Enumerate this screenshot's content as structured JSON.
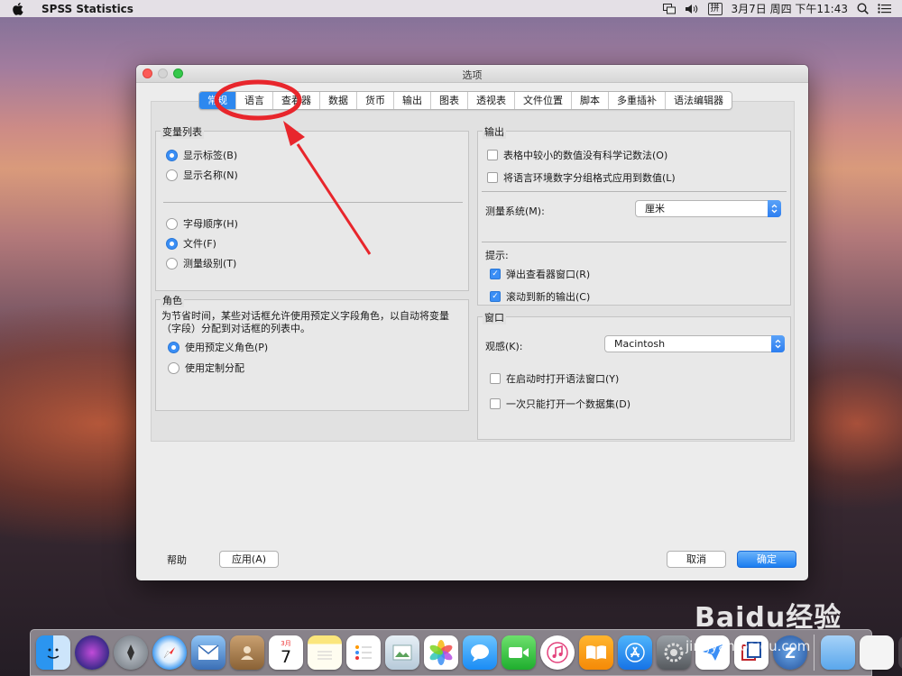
{
  "menubar": {
    "app_name": "SPSS Statistics",
    "input_method": "拼",
    "datetime": "3月7日 周四 下午11:43"
  },
  "window": {
    "title": "选项",
    "tabs": [
      "常规",
      "语言",
      "查看器",
      "数据",
      "货币",
      "输出",
      "图表",
      "透视表",
      "文件位置",
      "脚本",
      "多重插补",
      "语法编辑器"
    ],
    "active_tab": "常规"
  },
  "variable_list": {
    "title": "变量列表",
    "display_label": "显示标签(B)",
    "display_name": "显示名称(N)",
    "alphabetical": "字母顺序(H)",
    "file": "文件(F)",
    "measurement_level": "测量级别(T)"
  },
  "roles": {
    "title": "角色",
    "description": "为节省时间，某些对话框允许使用预定义字段角色，以自动将变量（字段）分配到对话框的列表中。",
    "use_predefined": "使用预定义角色(P)",
    "use_custom": "使用定制分配"
  },
  "output": {
    "title": "输出",
    "no_sci_notation": "表格中较小的数值没有科学记数法(O)",
    "apply_locale_format": "将语言环境数字分组格式应用到数值(L)",
    "measurement_system_label": "测量系统(M):",
    "measurement_system_value": "厘米",
    "notification_label": "提示:",
    "popup_viewer": "弹出查看器窗口(R)",
    "scroll_to_output": "滚动到新的输出(C)"
  },
  "window_group": {
    "title": "窗口",
    "look_feel_label": "观感(K):",
    "look_feel_value": "Macintosh",
    "open_syntax_startup": "在启动时打开语法窗口(Y)",
    "open_one_dataset": "一次只能打开一个数据集(D)"
  },
  "buttons": {
    "help": "帮助",
    "apply": "应用(A)",
    "cancel": "取消",
    "ok": "确定"
  },
  "dock": {
    "calendar_month": "3月",
    "calendar_day": "7"
  },
  "watermark": {
    "main": "Baidu经验",
    "url": "jingyan.baidu.com"
  },
  "colors": {
    "accent": "#2d88ef",
    "annotation": "#e8262c"
  }
}
